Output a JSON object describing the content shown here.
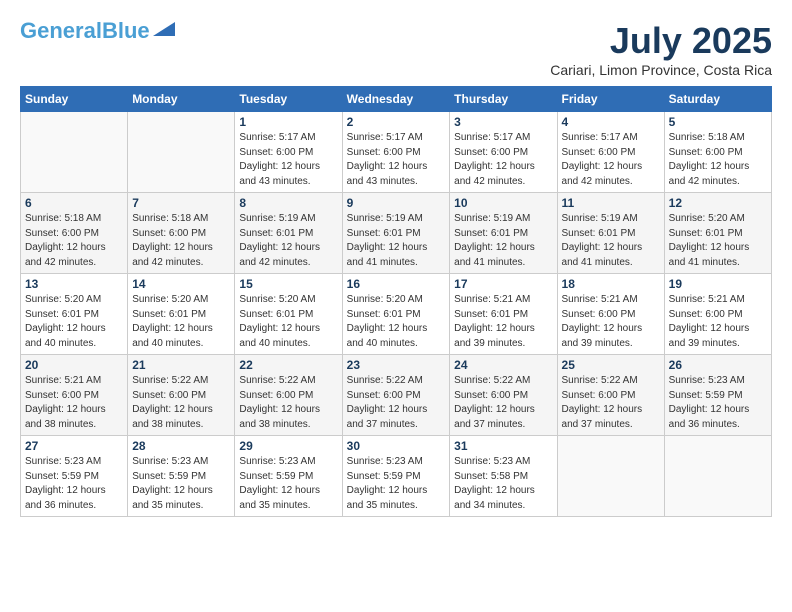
{
  "header": {
    "logo_line1": "General",
    "logo_line2": "Blue",
    "month_year": "July 2025",
    "location": "Cariari, Limon Province, Costa Rica"
  },
  "weekdays": [
    "Sunday",
    "Monday",
    "Tuesday",
    "Wednesday",
    "Thursday",
    "Friday",
    "Saturday"
  ],
  "weeks": [
    [
      null,
      null,
      {
        "day": "1",
        "sunrise": "Sunrise: 5:17 AM",
        "sunset": "Sunset: 6:00 PM",
        "daylight": "Daylight: 12 hours and 43 minutes."
      },
      {
        "day": "2",
        "sunrise": "Sunrise: 5:17 AM",
        "sunset": "Sunset: 6:00 PM",
        "daylight": "Daylight: 12 hours and 43 minutes."
      },
      {
        "day": "3",
        "sunrise": "Sunrise: 5:17 AM",
        "sunset": "Sunset: 6:00 PM",
        "daylight": "Daylight: 12 hours and 42 minutes."
      },
      {
        "day": "4",
        "sunrise": "Sunrise: 5:17 AM",
        "sunset": "Sunset: 6:00 PM",
        "daylight": "Daylight: 12 hours and 42 minutes."
      },
      {
        "day": "5",
        "sunrise": "Sunrise: 5:18 AM",
        "sunset": "Sunset: 6:00 PM",
        "daylight": "Daylight: 12 hours and 42 minutes."
      }
    ],
    [
      {
        "day": "6",
        "sunrise": "Sunrise: 5:18 AM",
        "sunset": "Sunset: 6:00 PM",
        "daylight": "Daylight: 12 hours and 42 minutes."
      },
      {
        "day": "7",
        "sunrise": "Sunrise: 5:18 AM",
        "sunset": "Sunset: 6:00 PM",
        "daylight": "Daylight: 12 hours and 42 minutes."
      },
      {
        "day": "8",
        "sunrise": "Sunrise: 5:19 AM",
        "sunset": "Sunset: 6:01 PM",
        "daylight": "Daylight: 12 hours and 42 minutes."
      },
      {
        "day": "9",
        "sunrise": "Sunrise: 5:19 AM",
        "sunset": "Sunset: 6:01 PM",
        "daylight": "Daylight: 12 hours and 41 minutes."
      },
      {
        "day": "10",
        "sunrise": "Sunrise: 5:19 AM",
        "sunset": "Sunset: 6:01 PM",
        "daylight": "Daylight: 12 hours and 41 minutes."
      },
      {
        "day": "11",
        "sunrise": "Sunrise: 5:19 AM",
        "sunset": "Sunset: 6:01 PM",
        "daylight": "Daylight: 12 hours and 41 minutes."
      },
      {
        "day": "12",
        "sunrise": "Sunrise: 5:20 AM",
        "sunset": "Sunset: 6:01 PM",
        "daylight": "Daylight: 12 hours and 41 minutes."
      }
    ],
    [
      {
        "day": "13",
        "sunrise": "Sunrise: 5:20 AM",
        "sunset": "Sunset: 6:01 PM",
        "daylight": "Daylight: 12 hours and 40 minutes."
      },
      {
        "day": "14",
        "sunrise": "Sunrise: 5:20 AM",
        "sunset": "Sunset: 6:01 PM",
        "daylight": "Daylight: 12 hours and 40 minutes."
      },
      {
        "day": "15",
        "sunrise": "Sunrise: 5:20 AM",
        "sunset": "Sunset: 6:01 PM",
        "daylight": "Daylight: 12 hours and 40 minutes."
      },
      {
        "day": "16",
        "sunrise": "Sunrise: 5:20 AM",
        "sunset": "Sunset: 6:01 PM",
        "daylight": "Daylight: 12 hours and 40 minutes."
      },
      {
        "day": "17",
        "sunrise": "Sunrise: 5:21 AM",
        "sunset": "Sunset: 6:01 PM",
        "daylight": "Daylight: 12 hours and 39 minutes."
      },
      {
        "day": "18",
        "sunrise": "Sunrise: 5:21 AM",
        "sunset": "Sunset: 6:00 PM",
        "daylight": "Daylight: 12 hours and 39 minutes."
      },
      {
        "day": "19",
        "sunrise": "Sunrise: 5:21 AM",
        "sunset": "Sunset: 6:00 PM",
        "daylight": "Daylight: 12 hours and 39 minutes."
      }
    ],
    [
      {
        "day": "20",
        "sunrise": "Sunrise: 5:21 AM",
        "sunset": "Sunset: 6:00 PM",
        "daylight": "Daylight: 12 hours and 38 minutes."
      },
      {
        "day": "21",
        "sunrise": "Sunrise: 5:22 AM",
        "sunset": "Sunset: 6:00 PM",
        "daylight": "Daylight: 12 hours and 38 minutes."
      },
      {
        "day": "22",
        "sunrise": "Sunrise: 5:22 AM",
        "sunset": "Sunset: 6:00 PM",
        "daylight": "Daylight: 12 hours and 38 minutes."
      },
      {
        "day": "23",
        "sunrise": "Sunrise: 5:22 AM",
        "sunset": "Sunset: 6:00 PM",
        "daylight": "Daylight: 12 hours and 37 minutes."
      },
      {
        "day": "24",
        "sunrise": "Sunrise: 5:22 AM",
        "sunset": "Sunset: 6:00 PM",
        "daylight": "Daylight: 12 hours and 37 minutes."
      },
      {
        "day": "25",
        "sunrise": "Sunrise: 5:22 AM",
        "sunset": "Sunset: 6:00 PM",
        "daylight": "Daylight: 12 hours and 37 minutes."
      },
      {
        "day": "26",
        "sunrise": "Sunrise: 5:23 AM",
        "sunset": "Sunset: 5:59 PM",
        "daylight": "Daylight: 12 hours and 36 minutes."
      }
    ],
    [
      {
        "day": "27",
        "sunrise": "Sunrise: 5:23 AM",
        "sunset": "Sunset: 5:59 PM",
        "daylight": "Daylight: 12 hours and 36 minutes."
      },
      {
        "day": "28",
        "sunrise": "Sunrise: 5:23 AM",
        "sunset": "Sunset: 5:59 PM",
        "daylight": "Daylight: 12 hours and 35 minutes."
      },
      {
        "day": "29",
        "sunrise": "Sunrise: 5:23 AM",
        "sunset": "Sunset: 5:59 PM",
        "daylight": "Daylight: 12 hours and 35 minutes."
      },
      {
        "day": "30",
        "sunrise": "Sunrise: 5:23 AM",
        "sunset": "Sunset: 5:59 PM",
        "daylight": "Daylight: 12 hours and 35 minutes."
      },
      {
        "day": "31",
        "sunrise": "Sunrise: 5:23 AM",
        "sunset": "Sunset: 5:58 PM",
        "daylight": "Daylight: 12 hours and 34 minutes."
      },
      null,
      null
    ]
  ]
}
